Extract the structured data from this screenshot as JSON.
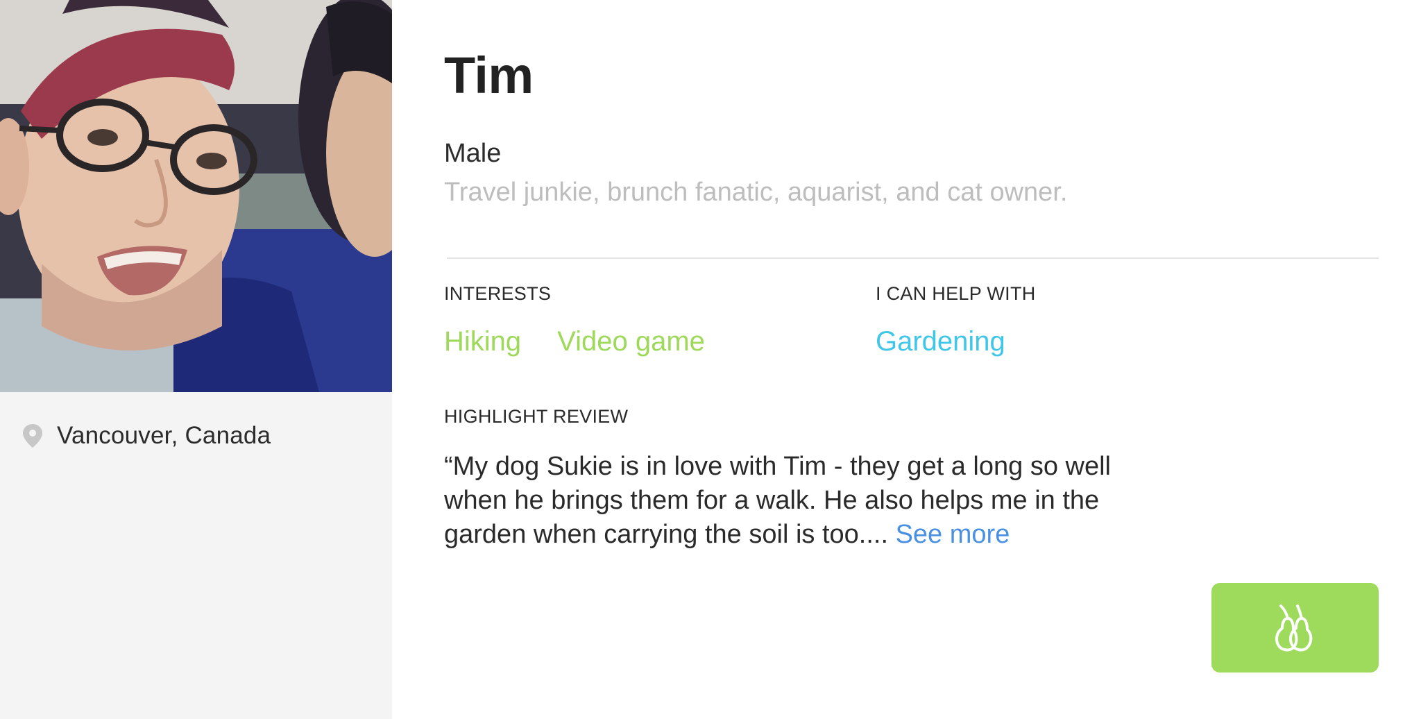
{
  "profile": {
    "name": "Tim",
    "gender": "Male",
    "tagline": "Travel junkie, brunch fanatic, aquarist, and cat owner.",
    "location": "Vancouver, Canada"
  },
  "sections": {
    "interests_label": "INTERESTS",
    "help_label": "I CAN HELP WITH",
    "highlight_label": "HIGHLIGHT REVIEW"
  },
  "interests": [
    "Hiking",
    "Video game"
  ],
  "help_with": [
    "Gardening"
  ],
  "review": {
    "text": "“My dog Sukie is in love with Tim - they get a long so well when he brings them for a walk. He also helps me in the garden when carrying the soil is too....",
    "see_more_label": "See more"
  },
  "colors": {
    "interest_tag": "#9ed95c",
    "help_tag": "#40c7e8",
    "link": "#4a90e2",
    "action_button": "#9edb5c",
    "tagline": "#bdbdbd",
    "left_panel_bg": "#f4f4f4"
  },
  "icons": {
    "location": "location-pin-icon",
    "action": "pear-pair-icon"
  }
}
